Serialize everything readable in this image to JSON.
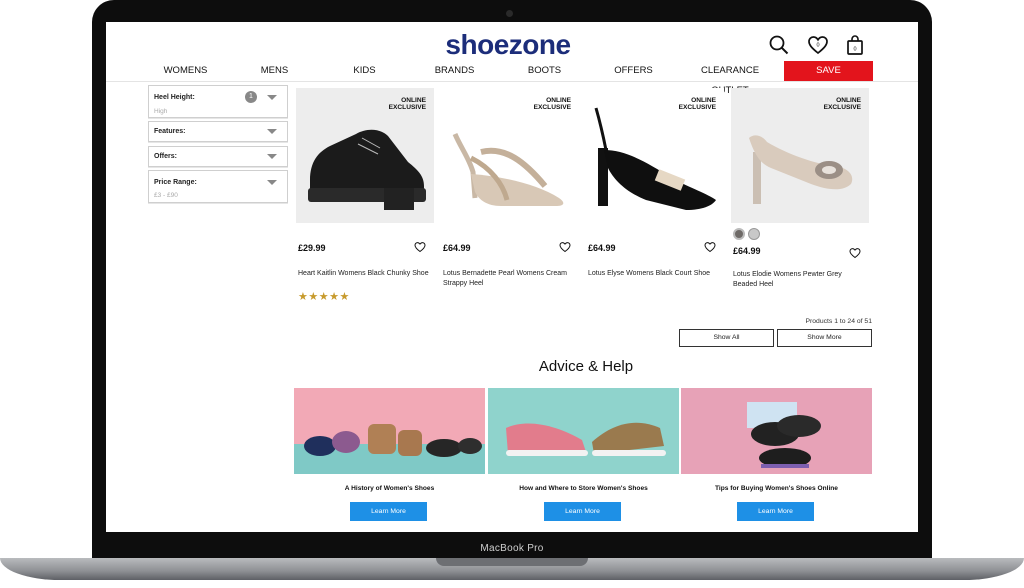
{
  "device": {
    "label": "MacBook Pro"
  },
  "site": {
    "logo": "shoezone",
    "header_icons": [
      "search-icon",
      "heart-icon",
      "bag-icon"
    ],
    "brand_color": "#1c2d7a",
    "accent_color": "#e3141c",
    "button_color": "#1e90e6"
  },
  "nav": {
    "items": [
      "WOMENS",
      "MENS",
      "KIDS",
      "BRANDS",
      "BOOTS",
      "OFFERS",
      "CLEARANCE OUTLET",
      "SAVE"
    ]
  },
  "filters": [
    {
      "label": "Heel Height:",
      "value": "High",
      "badge": "1"
    },
    {
      "label": "Features:"
    },
    {
      "label": "Offers:"
    },
    {
      "label": "Price Range:",
      "value": "£3 - £90"
    }
  ],
  "products": [
    {
      "badge_line1": "ONLINE",
      "badge_line2": "EXCLUSIVE",
      "price": "£29.99",
      "name": "Heart Kaitlin Womens Black Chunky Shoe",
      "rating": "★★★★★"
    },
    {
      "badge_line1": "ONLINE",
      "badge_line2": "EXCLUSIVE",
      "price": "£64.99",
      "name": "Lotus Bernadette Pearl Womens Cream Strappy Heel"
    },
    {
      "badge_line1": "ONLINE",
      "badge_line2": "EXCLUSIVE",
      "price": "£64.99",
      "name": "Lotus Elyse Womens Black Court Shoe"
    },
    {
      "badge_line1": "ONLINE",
      "badge_line2": "EXCLUSIVE",
      "price": "£64.99",
      "name": "Lotus Elodie Womens Pewter Grey Beaded Heel"
    }
  ],
  "listing": {
    "count_text": "Products 1 to 24 of 51",
    "show_all": "Show All",
    "show_more": "Show More"
  },
  "advice": {
    "title": "Advice & Help",
    "articles": [
      {
        "title": "A History of Women's Shoes",
        "button": "Learn More"
      },
      {
        "title": "How and Where to Store Women's Shoes",
        "button": "Learn More"
      },
      {
        "title": "Tips for Buying Women's Shoes Online",
        "button": "Learn More"
      }
    ]
  }
}
